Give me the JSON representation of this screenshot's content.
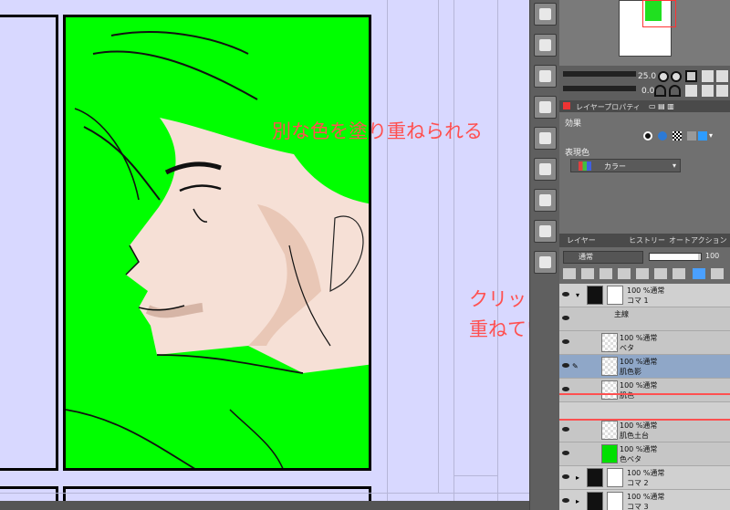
{
  "annotations": {
    "color_note": "別な色を塗り重ねられる",
    "clip_note_1": "クリッピングは",
    "clip_note_2": "重ねていくつもできる"
  },
  "navigator": {
    "rotate_value": "25.0",
    "angle_value": "0.0"
  },
  "tabs": {
    "layer_property": "レイヤープロパティ",
    "layer": "レイヤー",
    "history": "ヒストリー",
    "auto_action": "オートアクション"
  },
  "properties": {
    "effect_label": "効果",
    "expression_color_label": "表現色",
    "expression_color_value": "カラー"
  },
  "layer_panel": {
    "blend_mode": "通常",
    "opacity": "100",
    "layers": [
      {
        "line1": "100 %通常",
        "line2": "コマ 1"
      },
      {
        "line1": "",
        "line2": "主線"
      },
      {
        "line1": "100 %通常",
        "line2": "ベタ"
      },
      {
        "line1": "100 %通常",
        "line2": "肌色影"
      },
      {
        "line1": "100 %通常",
        "line2": "肌色"
      },
      {
        "line1": "100 %通常",
        "line2": "肌色土台"
      },
      {
        "line1": "100 %通常",
        "line2": "色ベタ"
      },
      {
        "line1": "100 %通常",
        "line2": "コマ 2"
      },
      {
        "line1": "100 %通常",
        "line2": "コマ 3"
      }
    ]
  },
  "colors": {
    "accent_annotation": "#ff5050",
    "canvas_bg": "#d8d8ff",
    "panel_fill": "#00ff00",
    "selected_layer": "#8fa7c8"
  }
}
